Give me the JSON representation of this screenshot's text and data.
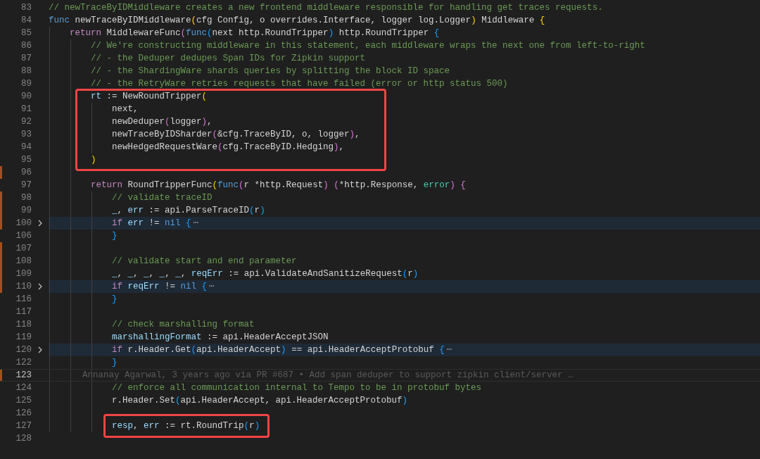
{
  "editor": {
    "lines": [
      {
        "number": "83",
        "modified": false,
        "folded": false,
        "current": false,
        "boxed": false,
        "tokens": [
          {
            "kind": "comment",
            "text": "// newTraceByIDMiddleware creates a new frontend middleware responsible for handling get traces requests."
          }
        ]
      },
      {
        "number": "84",
        "modified": false,
        "folded": false,
        "current": false,
        "boxed": false,
        "tokens": [
          {
            "kind": "storage",
            "text": "func"
          },
          {
            "kind": "plain",
            "text": " newTraceByIDMiddleware"
          },
          {
            "kind": "b1",
            "text": "("
          },
          {
            "kind": "plain",
            "text": "cfg Config, o overrides.Interface, logger log.Logger"
          },
          {
            "kind": "b1",
            "text": ")"
          },
          {
            "kind": "plain",
            "text": " Middleware "
          },
          {
            "kind": "b1",
            "text": "{"
          }
        ]
      },
      {
        "number": "85",
        "modified": false,
        "folded": false,
        "current": false,
        "boxed": false,
        "tokens": [
          {
            "kind": "keyword",
            "text": "    return"
          },
          {
            "kind": "plain",
            "text": " MiddlewareFunc"
          },
          {
            "kind": "b2",
            "text": "("
          },
          {
            "kind": "storage",
            "text": "func"
          },
          {
            "kind": "b3",
            "text": "("
          },
          {
            "kind": "plain",
            "text": "next http.RoundTripper"
          },
          {
            "kind": "b3",
            "text": ")"
          },
          {
            "kind": "plain",
            "text": " http.RoundTripper "
          },
          {
            "kind": "b3",
            "text": "{"
          }
        ]
      },
      {
        "number": "86",
        "modified": false,
        "folded": false,
        "current": false,
        "boxed": false,
        "tokens": [
          {
            "kind": "comment",
            "text": "        // We're constructing middleware in this statement, each middleware wraps the next one from left-to-right"
          }
        ]
      },
      {
        "number": "87",
        "modified": false,
        "folded": false,
        "current": false,
        "boxed": false,
        "tokens": [
          {
            "kind": "comment",
            "text": "        // - the Deduper dedupes Span IDs for Zipkin support"
          }
        ]
      },
      {
        "number": "88",
        "modified": false,
        "folded": false,
        "current": false,
        "boxed": false,
        "tokens": [
          {
            "kind": "comment",
            "text": "        // - the ShardingWare shards queries by splitting the block ID space"
          }
        ]
      },
      {
        "number": "89",
        "modified": false,
        "folded": false,
        "current": false,
        "boxed": false,
        "tokens": [
          {
            "kind": "comment",
            "text": "        // - the RetryWare retries requests that have failed (error or http status 500)"
          }
        ]
      },
      {
        "number": "90",
        "modified": false,
        "folded": false,
        "current": false,
        "boxed": true,
        "tokens": [
          {
            "kind": "var",
            "text": "        rt"
          },
          {
            "kind": "plain",
            "text": " := NewRoundTripper"
          },
          {
            "kind": "b1",
            "text": "("
          }
        ]
      },
      {
        "number": "91",
        "modified": false,
        "folded": false,
        "current": false,
        "boxed": true,
        "tokens": [
          {
            "kind": "plain",
            "text": "            next,"
          }
        ]
      },
      {
        "number": "92",
        "modified": false,
        "folded": false,
        "current": false,
        "boxed": true,
        "tokens": [
          {
            "kind": "plain",
            "text": "            newDeduper"
          },
          {
            "kind": "b2",
            "text": "("
          },
          {
            "kind": "plain",
            "text": "logger"
          },
          {
            "kind": "b2",
            "text": ")"
          },
          {
            "kind": "plain",
            "text": ","
          }
        ]
      },
      {
        "number": "93",
        "modified": false,
        "folded": false,
        "current": false,
        "boxed": true,
        "tokens": [
          {
            "kind": "plain",
            "text": "            newTraceByIDSharder"
          },
          {
            "kind": "b2",
            "text": "("
          },
          {
            "kind": "plain",
            "text": "&cfg.TraceByID, o, logger"
          },
          {
            "kind": "b2",
            "text": ")"
          },
          {
            "kind": "plain",
            "text": ","
          }
        ]
      },
      {
        "number": "94",
        "modified": false,
        "folded": false,
        "current": false,
        "boxed": true,
        "tokens": [
          {
            "kind": "plain",
            "text": "            newHedgedRequestWare"
          },
          {
            "kind": "b2",
            "text": "("
          },
          {
            "kind": "plain",
            "text": "cfg.TraceByID.Hedging"
          },
          {
            "kind": "b2",
            "text": ")"
          },
          {
            "kind": "plain",
            "text": ","
          }
        ]
      },
      {
        "number": "95",
        "modified": false,
        "folded": false,
        "current": false,
        "boxed": true,
        "tokens": [
          {
            "kind": "b1",
            "text": "        )"
          }
        ]
      },
      {
        "number": "96",
        "modified": true,
        "folded": false,
        "current": false,
        "boxed": false
      },
      {
        "number": "97",
        "modified": false,
        "folded": false,
        "current": false,
        "boxed": false,
        "tokens": [
          {
            "kind": "keyword",
            "text": "        return"
          },
          {
            "kind": "plain",
            "text": " RoundTripperFunc"
          },
          {
            "kind": "b1",
            "text": "("
          },
          {
            "kind": "storage",
            "text": "func"
          },
          {
            "kind": "b2",
            "text": "("
          },
          {
            "kind": "plain",
            "text": "r *http.Request"
          },
          {
            "kind": "b2",
            "text": ")"
          },
          {
            "kind": "b2",
            "text": " ("
          },
          {
            "kind": "plain",
            "text": "*http.Response, "
          },
          {
            "kind": "type",
            "text": "error"
          },
          {
            "kind": "b2",
            "text": ")"
          },
          {
            "kind": "b2",
            "text": " {"
          }
        ]
      },
      {
        "number": "98",
        "modified": true,
        "folded": false,
        "current": false,
        "boxed": false,
        "tokens": [
          {
            "kind": "comment",
            "text": "            // validate traceID"
          }
        ]
      },
      {
        "number": "99",
        "modified": true,
        "folded": false,
        "current": false,
        "boxed": false,
        "tokens": [
          {
            "kind": "var",
            "text": "            _"
          },
          {
            "kind": "plain",
            "text": ", "
          },
          {
            "kind": "var",
            "text": "err"
          },
          {
            "kind": "plain",
            "text": " := api.ParseTraceID"
          },
          {
            "kind": "b3",
            "text": "("
          },
          {
            "kind": "plain",
            "text": "r"
          },
          {
            "kind": "b3",
            "text": ")"
          }
        ]
      },
      {
        "number": "100",
        "modified": true,
        "folded": true,
        "current": false,
        "boxed": false,
        "tokens": [
          {
            "kind": "keyword",
            "text": "            if"
          },
          {
            "kind": "var",
            "text": " err"
          },
          {
            "kind": "plain",
            "text": " != "
          },
          {
            "kind": "storage",
            "text": "nil"
          },
          {
            "kind": "b3",
            "text": " {"
          },
          {
            "kind": "ellipsis",
            "text": "⋯"
          }
        ]
      },
      {
        "number": "106",
        "modified": false,
        "folded": false,
        "current": false,
        "boxed": false,
        "tokens": [
          {
            "kind": "b3",
            "text": "            }"
          }
        ]
      },
      {
        "number": "107",
        "modified": true,
        "folded": false,
        "current": false,
        "boxed": false
      },
      {
        "number": "108",
        "modified": true,
        "folded": false,
        "current": false,
        "boxed": false,
        "tokens": [
          {
            "kind": "comment",
            "text": "            // validate start and end parameter"
          }
        ]
      },
      {
        "number": "109",
        "modified": true,
        "folded": false,
        "current": false,
        "boxed": false,
        "tokens": [
          {
            "kind": "var",
            "text": "            _"
          },
          {
            "kind": "plain",
            "text": ", "
          },
          {
            "kind": "var",
            "text": "_"
          },
          {
            "kind": "plain",
            "text": ", "
          },
          {
            "kind": "var",
            "text": "_"
          },
          {
            "kind": "plain",
            "text": ", "
          },
          {
            "kind": "var",
            "text": "_"
          },
          {
            "kind": "plain",
            "text": ", "
          },
          {
            "kind": "var",
            "text": "_"
          },
          {
            "kind": "plain",
            "text": ", "
          },
          {
            "kind": "var",
            "text": "reqErr"
          },
          {
            "kind": "plain",
            "text": " := api.ValidateAndSanitizeRequest"
          },
          {
            "kind": "b3",
            "text": "("
          },
          {
            "kind": "plain",
            "text": "r"
          },
          {
            "kind": "b3",
            "text": ")"
          }
        ]
      },
      {
        "number": "110",
        "modified": true,
        "folded": true,
        "current": false,
        "boxed": false,
        "tokens": [
          {
            "kind": "keyword",
            "text": "            if"
          },
          {
            "kind": "var",
            "text": " reqErr"
          },
          {
            "kind": "plain",
            "text": " != "
          },
          {
            "kind": "storage",
            "text": "nil"
          },
          {
            "kind": "b3",
            "text": " {"
          },
          {
            "kind": "ellipsis",
            "text": "⋯"
          }
        ]
      },
      {
        "number": "116",
        "modified": false,
        "folded": false,
        "current": false,
        "boxed": false,
        "tokens": [
          {
            "kind": "b3",
            "text": "            }"
          }
        ]
      },
      {
        "number": "117",
        "modified": false,
        "folded": false,
        "current": false,
        "boxed": false
      },
      {
        "number": "118",
        "modified": false,
        "folded": false,
        "current": false,
        "boxed": false,
        "tokens": [
          {
            "kind": "comment",
            "text": "            // check marshalling format"
          }
        ]
      },
      {
        "number": "119",
        "modified": false,
        "folded": false,
        "current": false,
        "boxed": false,
        "tokens": [
          {
            "kind": "var",
            "text": "            marshallingFormat"
          },
          {
            "kind": "plain",
            "text": " := api.HeaderAcceptJSON"
          }
        ]
      },
      {
        "number": "120",
        "modified": false,
        "folded": true,
        "current": false,
        "boxed": false,
        "tokens": [
          {
            "kind": "keyword",
            "text": "            if"
          },
          {
            "kind": "plain",
            "text": " r.Header.Get"
          },
          {
            "kind": "b3",
            "text": "("
          },
          {
            "kind": "plain",
            "text": "api.HeaderAccept"
          },
          {
            "kind": "b3",
            "text": ")"
          },
          {
            "kind": "plain",
            "text": " == api.HeaderAcceptProtobuf "
          },
          {
            "kind": "b3",
            "text": "{"
          },
          {
            "kind": "ellipsis",
            "text": "⋯"
          }
        ]
      },
      {
        "number": "122",
        "modified": false,
        "folded": false,
        "current": false,
        "boxed": false,
        "tokens": [
          {
            "kind": "b3",
            "text": "            }"
          }
        ]
      },
      {
        "number": "123",
        "modified": true,
        "folded": false,
        "current": true,
        "boxed": false,
        "blame": "Annanay Agarwal, 3 years ago via PR #687 • Add span deduper to support zipkin client/server …"
      },
      {
        "number": "124",
        "modified": false,
        "folded": false,
        "current": false,
        "boxed": false,
        "tokens": [
          {
            "kind": "comment",
            "text": "            // enforce all communication internal to Tempo to be in protobuf bytes"
          }
        ]
      },
      {
        "number": "125",
        "modified": false,
        "folded": false,
        "current": false,
        "boxed": false,
        "tokens": [
          {
            "kind": "plain",
            "text": "            r.Header.Set"
          },
          {
            "kind": "b3",
            "text": "("
          },
          {
            "kind": "plain",
            "text": "api.HeaderAccept, api.HeaderAcceptProtobuf"
          },
          {
            "kind": "b3",
            "text": ")"
          }
        ]
      },
      {
        "number": "126",
        "modified": false,
        "folded": false,
        "current": false,
        "boxed": false
      },
      {
        "number": "127",
        "modified": false,
        "folded": false,
        "current": false,
        "boxed": true,
        "tokens": [
          {
            "kind": "var",
            "text": "            resp"
          },
          {
            "kind": "plain",
            "text": ", "
          },
          {
            "kind": "var",
            "text": "err"
          },
          {
            "kind": "plain",
            "text": " := rt.RoundTrip"
          },
          {
            "kind": "b3",
            "text": "("
          },
          {
            "kind": "plain",
            "text": "r"
          },
          {
            "kind": "b3",
            "text": ")"
          }
        ]
      },
      {
        "number": "128",
        "modified": false,
        "folded": false,
        "current": false,
        "boxed": false
      }
    ]
  }
}
